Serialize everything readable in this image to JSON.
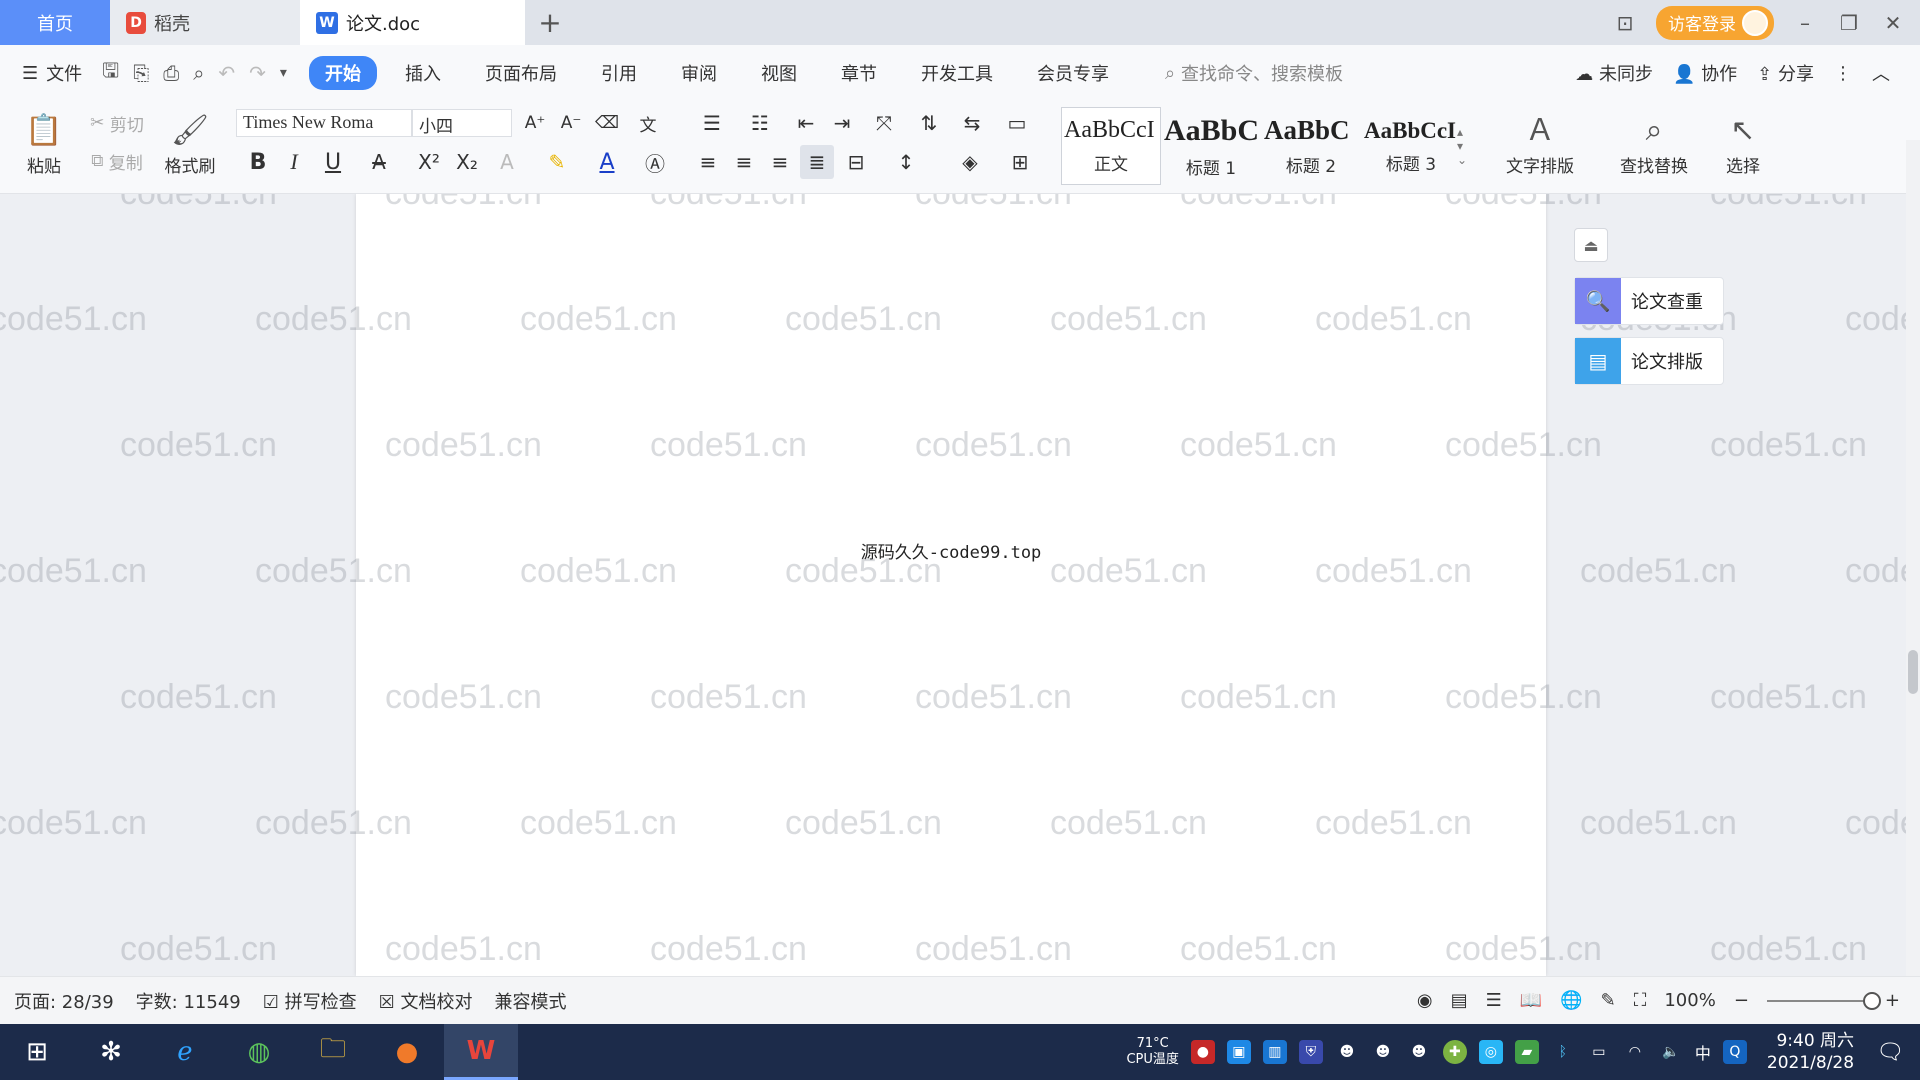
{
  "tabs": {
    "home": "首页",
    "daoke": "稻壳",
    "doc": "论文.doc",
    "add": "+"
  },
  "window": {
    "login_label": "访客登录",
    "minimize": "–",
    "restore": "❐",
    "close": "✕",
    "layout_icon": "⊡"
  },
  "menu": {
    "file": "文件",
    "items": [
      "开始",
      "插入",
      "页面布局",
      "引用",
      "审阅",
      "视图",
      "章节",
      "开发工具",
      "会员专享"
    ],
    "search_placeholder": "查找命令、搜索模板",
    "sync": "未同步",
    "collab": "协作",
    "share": "分享"
  },
  "ribbon": {
    "paste": "粘贴",
    "cut": "剪切",
    "copy": "复制",
    "format_painter": "格式刷",
    "font_name": "Times New Roma",
    "font_size": "小四",
    "styles": [
      {
        "preview": "AaBbCcI",
        "name": "正文"
      },
      {
        "preview": "AaBbC",
        "name": "标题 1"
      },
      {
        "preview": "AaBbC",
        "name": "标题 2"
      },
      {
        "preview": "AaBbCcI",
        "name": "标题 3"
      }
    ],
    "text_layout": "文字排版",
    "find_replace": "查找替换",
    "select": "选择"
  },
  "document": {
    "body_text": "源码久久-code99.top",
    "watermark": "code51.cn"
  },
  "side_panel": {
    "check": "论文查重",
    "layout": "论文排版"
  },
  "status": {
    "page": "页面: 28/39",
    "words": "字数: 11549",
    "spell_check": "拼写检查",
    "doc_check": "文档校对",
    "compat": "兼容模式",
    "zoom": "100%"
  },
  "taskbar": {
    "cpu_temp": "71°C",
    "cpu_label": "CPU温度",
    "ime": "中",
    "time": "9:40 周六",
    "date": "2021/8/28"
  },
  "colors": {
    "accent": "#3f86f7",
    "login": "#f7a531",
    "taskbar": "#1c2b4a"
  }
}
